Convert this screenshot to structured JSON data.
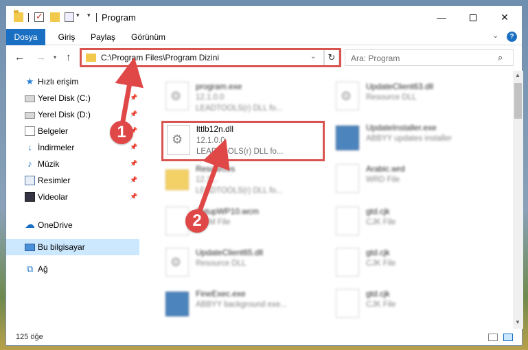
{
  "window": {
    "title": "Program"
  },
  "ribbon": {
    "tabs": [
      "Dosya",
      "Giriş",
      "Paylaş",
      "Görünüm"
    ]
  },
  "nav": {
    "address": "C:\\Program Files\\Program Dizini",
    "search_placeholder": "Ara: Program"
  },
  "sidebar": {
    "items": [
      {
        "label": "Hızlı erişim",
        "icon": "star-icon",
        "pinned": false
      },
      {
        "label": "Yerel Disk (C:)",
        "icon": "drive-icon",
        "pinned": true
      },
      {
        "label": "Yerel Disk (D:)",
        "icon": "drive-icon",
        "pinned": true
      },
      {
        "label": "Belgeler",
        "icon": "documents-icon",
        "pinned": true
      },
      {
        "label": "İndirmeler",
        "icon": "download-icon",
        "pinned": true
      },
      {
        "label": "Müzik",
        "icon": "music-icon",
        "pinned": true
      },
      {
        "label": "Resimler",
        "icon": "pictures-icon",
        "pinned": true
      },
      {
        "label": "Videolar",
        "icon": "videos-icon",
        "pinned": true
      },
      {
        "label": "OneDrive",
        "icon": "cloud-icon",
        "pinned": false
      },
      {
        "label": "Bu bilgisayar",
        "icon": "computer-icon",
        "pinned": false,
        "selected": true
      },
      {
        "label": "Ağ",
        "icon": "network-icon",
        "pinned": false
      }
    ]
  },
  "files": {
    "focus": {
      "name": "lttlb12n.dll",
      "line1": "12.1.0.0",
      "line2": "LEADTOOLS(r) DLL fo..."
    },
    "left": [
      {
        "name": "program.exe",
        "line1": "12.1.0.0",
        "line2": "LEADTOOLS(r) DLL fo..."
      },
      {
        "name": "Resources",
        "line1": "12.1...",
        "line2": "LEADTOOLS(r) DLL fo..."
      },
      {
        "name": "SetupWP10.wcm",
        "line1": "WCM File",
        "line2": ""
      },
      {
        "name": "UpdateClient65.dll",
        "line1": "Resource DLL",
        "line2": ""
      },
      {
        "name": "FineExec.exe",
        "line1": "ABBYY background exe...",
        "line2": ""
      }
    ],
    "right": [
      {
        "name": "UpdateClient63.dll",
        "line1": "Resource DLL",
        "line2": ""
      },
      {
        "name": "UpdateInstaller.exe",
        "line1": "ABBYY updates installer",
        "line2": ""
      },
      {
        "name": "Arabic.wrd",
        "line1": "WRD File",
        "line2": ""
      },
      {
        "name": "gtd.cjk",
        "line1": "CJK File",
        "line2": ""
      },
      {
        "name": "gtd.cjk",
        "line1": "CJK File",
        "line2": ""
      },
      {
        "name": "gtd.cjk",
        "line1": "CJK File",
        "line2": ""
      }
    ]
  },
  "status": {
    "count": "125 öğe"
  },
  "annotations": {
    "callout1": "1",
    "callout2": "2"
  },
  "colors": {
    "accent": "#1a6fc2",
    "highlight": "#d9534f",
    "selected": "#cce8ff"
  }
}
